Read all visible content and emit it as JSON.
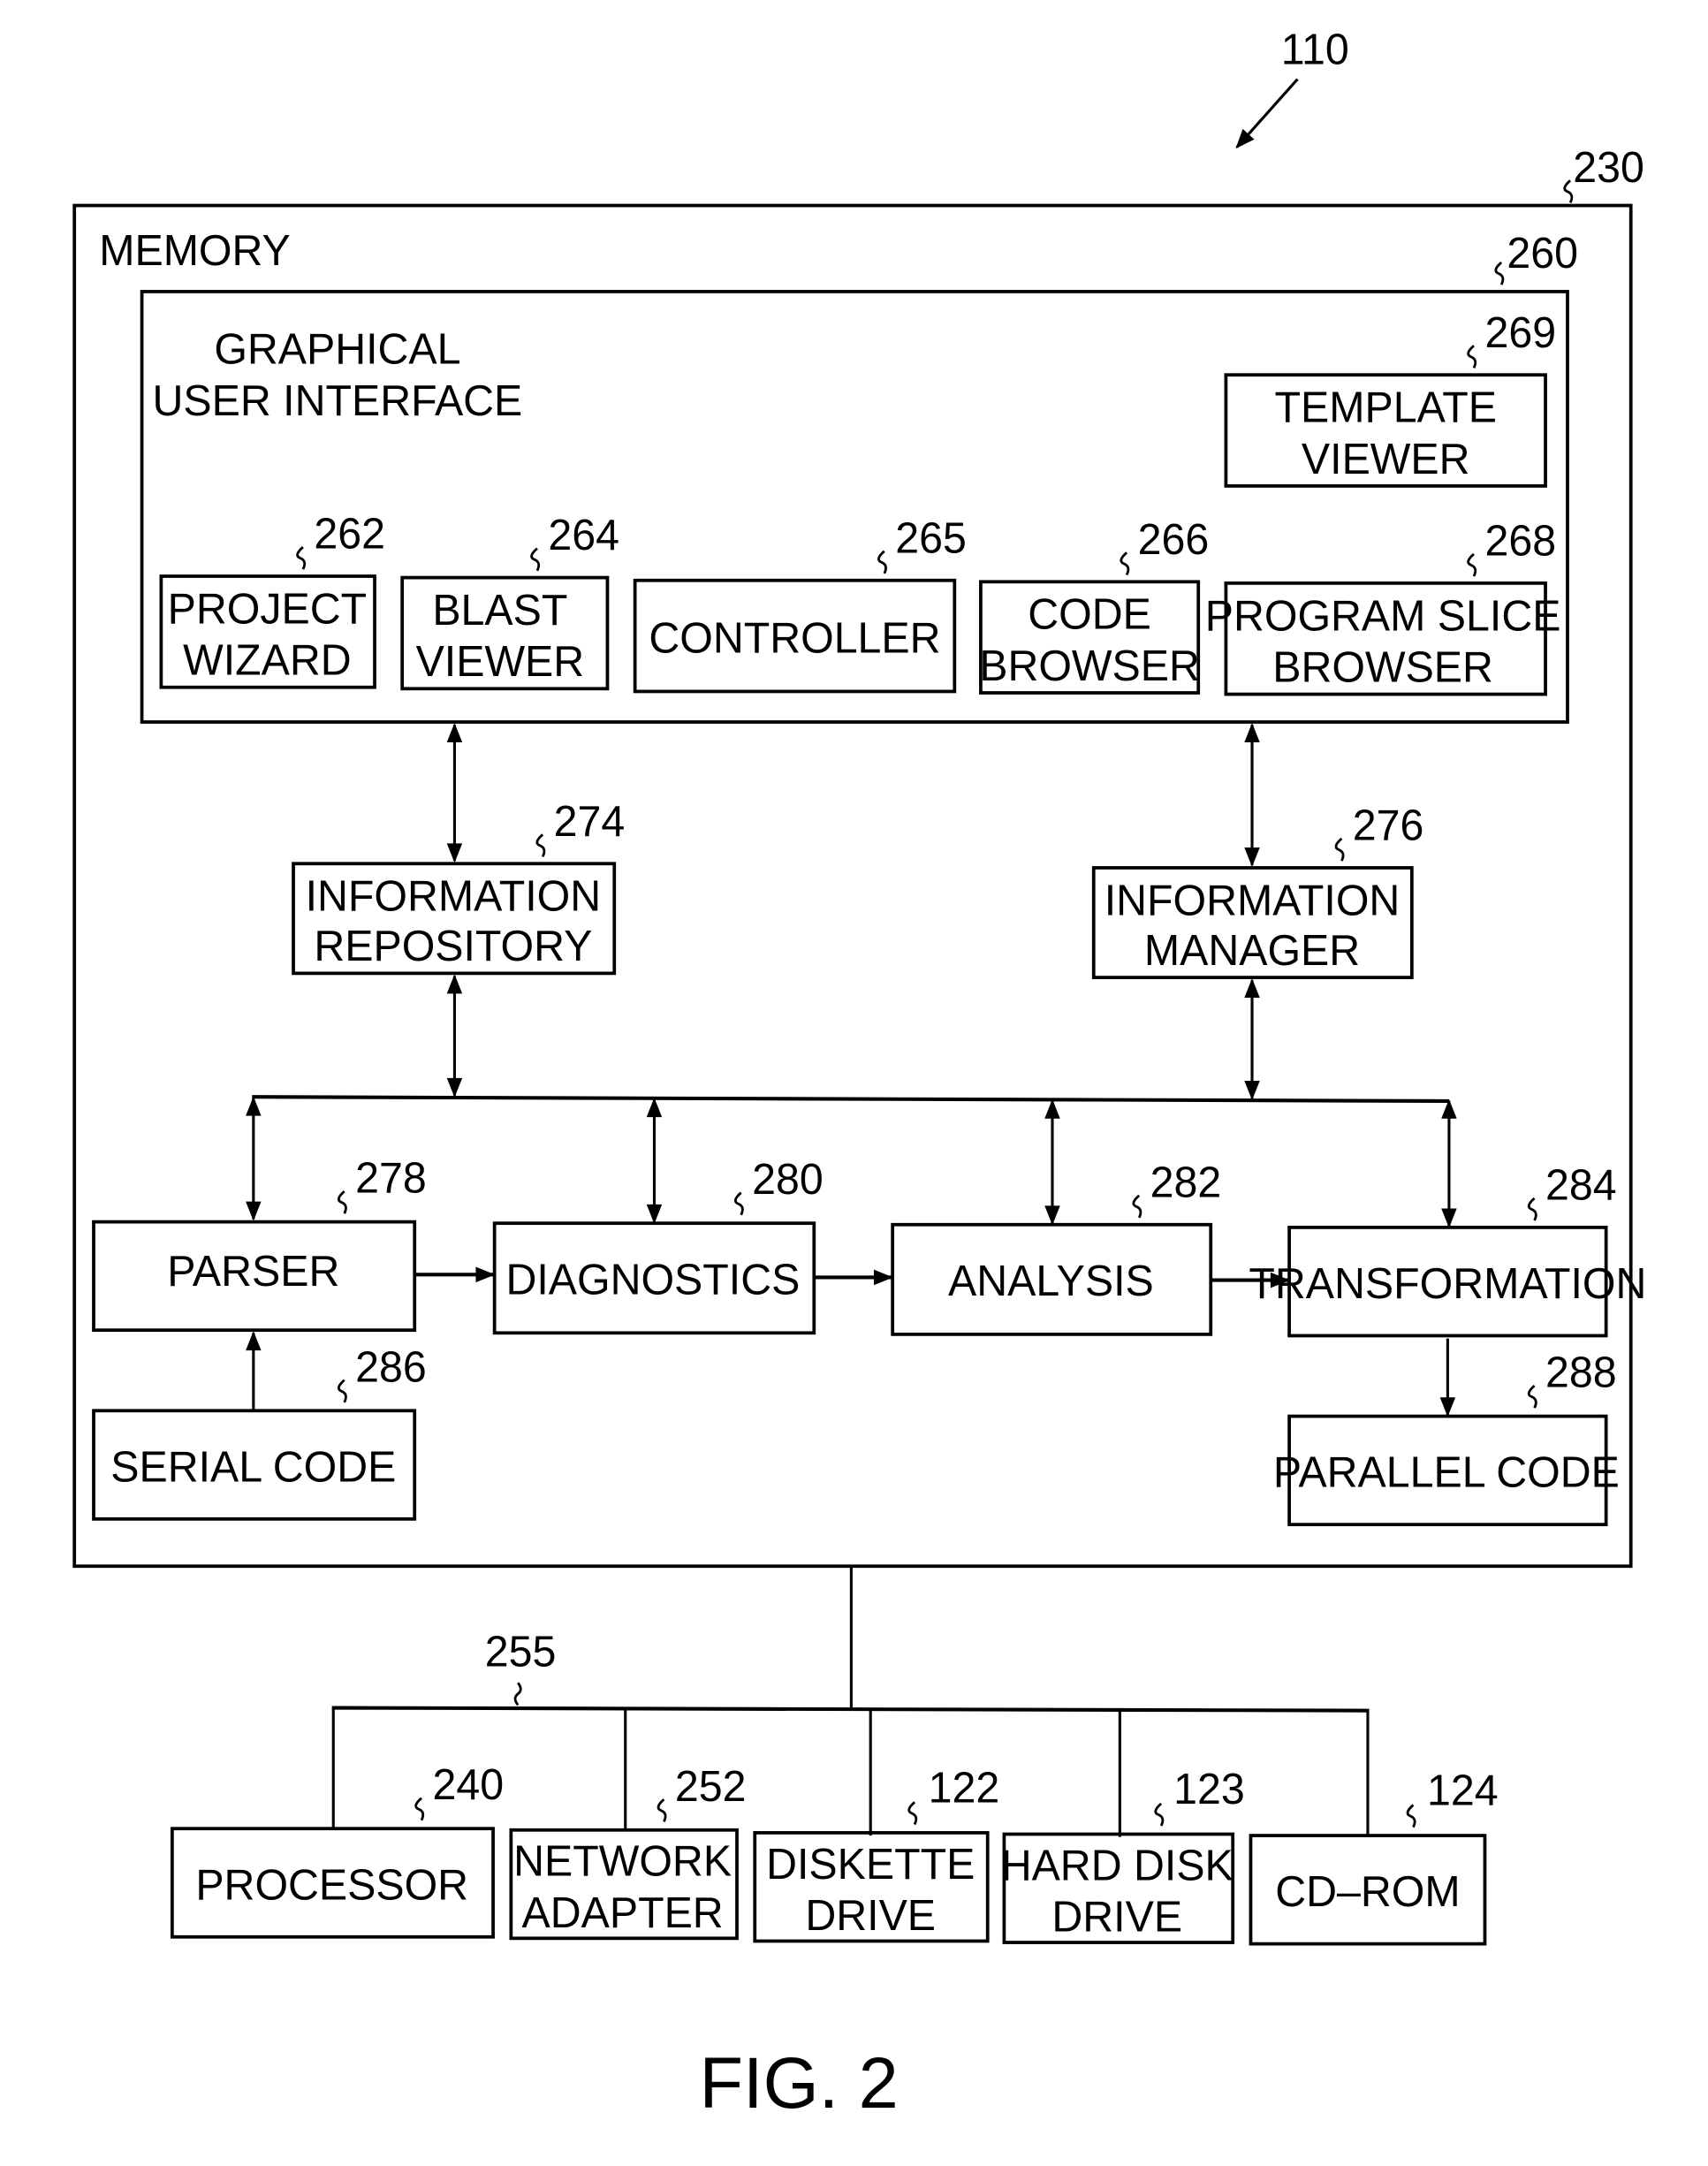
{
  "figure": {
    "title": "FIG. 2",
    "system_ref": "110"
  },
  "memory": {
    "label": "MEMORY",
    "ref": "230"
  },
  "gui": {
    "label_line1": "GRAPHICAL",
    "label_line2": "USER  INTERFACE",
    "ref": "260",
    "components": [
      {
        "id": "template-viewer",
        "lines": [
          "TEMPLATE",
          "VIEWER"
        ],
        "ref": "269"
      },
      {
        "id": "project-wizard",
        "lines": [
          "PROJECT",
          "WIZARD"
        ],
        "ref": "262"
      },
      {
        "id": "blast-viewer",
        "lines": [
          "BLAST",
          "VIEWER"
        ],
        "ref": "264"
      },
      {
        "id": "controller",
        "lines": [
          "CONTROLLER"
        ],
        "ref": "265"
      },
      {
        "id": "code-browser",
        "lines": [
          "CODE",
          "BROWSER"
        ],
        "ref": "266"
      },
      {
        "id": "program-slice-browser",
        "lines": [
          "PROGRAM  SLICE",
          "BROWSER"
        ],
        "ref": "268"
      }
    ]
  },
  "middle": [
    {
      "id": "information-repository",
      "lines": [
        "INFORMATION",
        "REPOSITORY"
      ],
      "ref": "274"
    },
    {
      "id": "information-manager",
      "lines": [
        "INFORMATION",
        "MANAGER"
      ],
      "ref": "276"
    }
  ],
  "pipeline": [
    {
      "id": "parser",
      "lines": [
        "PARSER"
      ],
      "ref": "278"
    },
    {
      "id": "diagnostics",
      "lines": [
        "DIAGNOSTICS"
      ],
      "ref": "280"
    },
    {
      "id": "analysis",
      "lines": [
        "ANALYSIS"
      ],
      "ref": "282"
    },
    {
      "id": "transformation",
      "lines": [
        "TRANSFORMATION"
      ],
      "ref": "284"
    }
  ],
  "io": [
    {
      "id": "serial-code",
      "lines": [
        "SERIAL  CODE"
      ],
      "ref": "286"
    },
    {
      "id": "parallel-code",
      "lines": [
        "PARALLEL  CODE"
      ],
      "ref": "288"
    }
  ],
  "bus": {
    "ref": "255"
  },
  "hardware": [
    {
      "id": "processor",
      "lines": [
        "PROCESSOR"
      ],
      "ref": "240"
    },
    {
      "id": "network-adapter",
      "lines": [
        "NETWORK",
        "ADAPTER"
      ],
      "ref": "252"
    },
    {
      "id": "diskette-drive",
      "lines": [
        "DISKETTE",
        "DRIVE"
      ],
      "ref": "122"
    },
    {
      "id": "hard-disk-drive",
      "lines": [
        "HARD  DISK",
        "DRIVE"
      ],
      "ref": "123"
    },
    {
      "id": "cd-rom",
      "lines": [
        "CD–ROM"
      ],
      "ref": "124"
    }
  ]
}
